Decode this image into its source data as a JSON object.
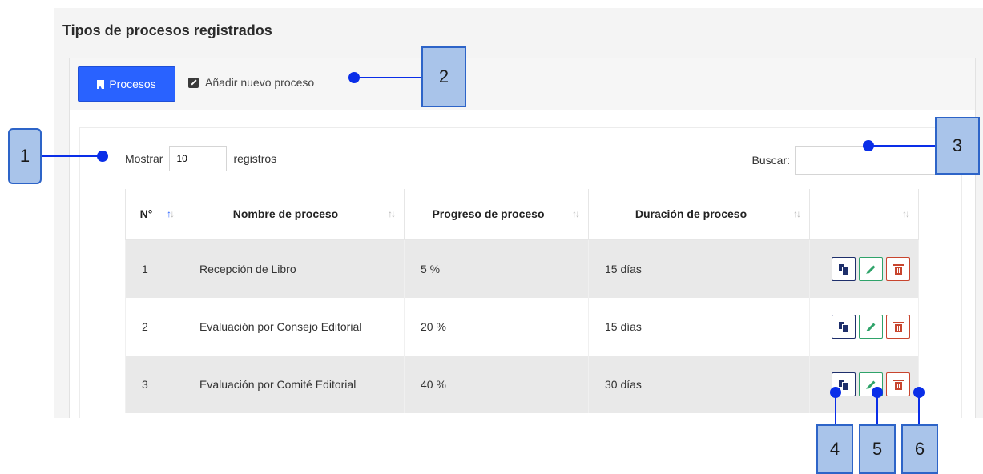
{
  "page": {
    "title": "Tipos de procesos registrados"
  },
  "toolbar": {
    "primary_button": {
      "label": "Procesos",
      "icon": "bookmark-icon"
    },
    "add_link": {
      "label": "Añadir nuevo proceso",
      "icon": "edit-square-icon"
    }
  },
  "table_controls": {
    "show_label": "Mostrar",
    "show_value": "10",
    "records_label": "registros",
    "search_label": "Buscar:",
    "search_value": ""
  },
  "table": {
    "columns": [
      {
        "label": "N°",
        "sort": "asc"
      },
      {
        "label": "Nombre de proceso",
        "sort": "none"
      },
      {
        "label": "Progreso de proceso",
        "sort": "none"
      },
      {
        "label": "Duración de proceso",
        "sort": "none"
      },
      {
        "label": "",
        "sort": "none"
      }
    ],
    "rows": [
      {
        "num": "1",
        "name": "Recepción de Libro",
        "progress": "5 %",
        "duration": "15 días"
      },
      {
        "num": "2",
        "name": "Evaluación por Consejo Editorial",
        "progress": "20 %",
        "duration": "15 días"
      },
      {
        "num": "3",
        "name": "Evaluación por Comité Editorial",
        "progress": "40 %",
        "duration": "30 días"
      }
    ],
    "row_actions": [
      "copy-icon",
      "pencil-icon",
      "trash-icon"
    ]
  },
  "callouts": [
    "1",
    "2",
    "3",
    "4",
    "5",
    "6"
  ],
  "colors": {
    "primary": "#2962ff",
    "copy_border": "#1e2f6b",
    "edit_border": "#2fa36a",
    "delete_border": "#c8452e",
    "callout_fill": "#a9c4ea",
    "callout_line": "#0a2ee8"
  }
}
